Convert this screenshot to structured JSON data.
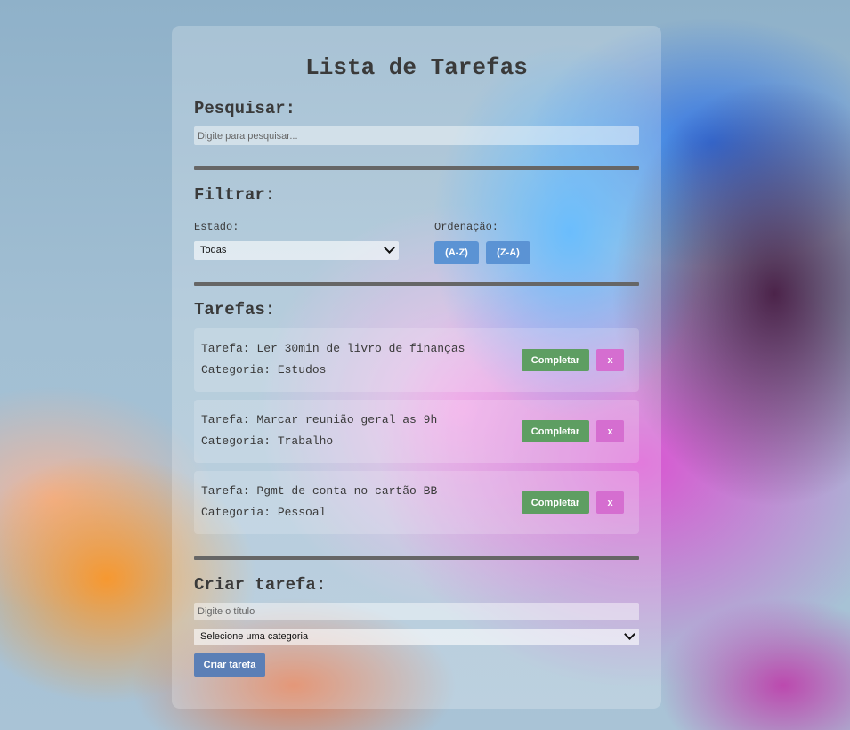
{
  "app": {
    "title": "Lista de Tarefas"
  },
  "search": {
    "heading": "Pesquisar:",
    "placeholder": "Digite para pesquisar..."
  },
  "filter": {
    "heading": "Filtrar:",
    "status_label": "Estado:",
    "status_selected": "Todas",
    "sort_label": "Ordenação:",
    "sort_asc": "(A-Z)",
    "sort_desc": "(Z-A)"
  },
  "tasks": {
    "heading": "Tarefas:",
    "complete_label": "Completar",
    "remove_label": "x",
    "items": [
      {
        "title": "Tarefa: Ler 30min de livro de finanças",
        "category": "Categoria: Estudos"
      },
      {
        "title": "Tarefa: Marcar reunião geral as 9h",
        "category": "Categoria: Trabalho"
      },
      {
        "title": "Tarefa: Pgmt de conta no cartão BB",
        "category": "Categoria: Pessoal"
      }
    ]
  },
  "create": {
    "heading": "Criar tarefa:",
    "title_placeholder": "Digite o título",
    "category_selected": "Selecione uma categoria",
    "submit_label": "Criar tarefa"
  },
  "colors": {
    "complete": "#5e9e62",
    "remove": "#d56ed0",
    "sort": "#5b93d4",
    "create": "#5b7fb6",
    "divider": "#666666"
  },
  "icons": [
    "chevron-down-icon"
  ]
}
